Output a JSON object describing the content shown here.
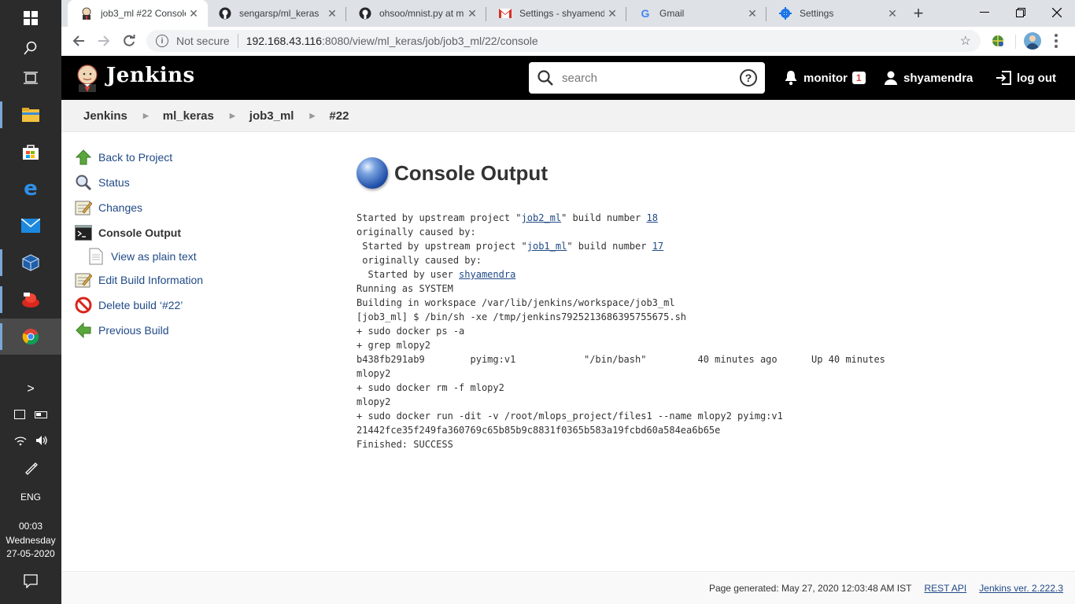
{
  "taskbar": {
    "clock_time": "00:03",
    "clock_day": "Wednesday",
    "clock_date": "27-05-2020",
    "language": "ENG",
    "chevron": ">"
  },
  "browser": {
    "tabs": [
      {
        "title": "job3_ml #22 Console",
        "icon": "jenkins-icon",
        "active": true
      },
      {
        "title": "sengarsp/ml_keras",
        "icon": "github-icon"
      },
      {
        "title": "ohsoo/mnist.py at m",
        "icon": "github-icon"
      },
      {
        "title": "Settings - shyamendr",
        "icon": "gmail-icon"
      },
      {
        "title": "Gmail",
        "icon": "google-icon"
      },
      {
        "title": "Settings",
        "icon": "gear-icon"
      }
    ],
    "new_tab": "+",
    "close": "✕",
    "not_secure": "Not secure",
    "url_host": "192.168.43.116",
    "url_path": ":8080/view/ml_keras/job/job3_ml/22/console"
  },
  "jenkins": {
    "title": "Jenkins",
    "search_placeholder": "search",
    "help": "?",
    "monitor_label": "monitor",
    "monitor_count": "1",
    "user": "shyamendra",
    "logout": "log out"
  },
  "breadcrumb": [
    "Jenkins",
    "ml_keras",
    "job3_ml",
    "#22"
  ],
  "sidepanel": {
    "back": "Back to Project",
    "status": "Status",
    "changes": "Changes",
    "console": "Console Output",
    "plain": "View as plain text",
    "edit": "Edit Build Information",
    "delete": "Delete build ‘#22’",
    "previous": "Previous Build"
  },
  "main": {
    "heading": "Console Output",
    "console": {
      "l1_pre": "Started by upstream project \"",
      "l1_link": "job2_ml",
      "l1_mid": "\" build number ",
      "l1_num": "18",
      "l2": "originally caused by:",
      "l3_pre": " Started by upstream project \"",
      "l3_link": "job1_ml",
      "l3_mid": "\" build number ",
      "l3_num": "17",
      "l4": " originally caused by:",
      "l5_pre": "  Started by user ",
      "l5_user": "shyamendra",
      "rest": "Running as SYSTEM\nBuilding in workspace /var/lib/jenkins/workspace/job3_ml\n[job3_ml] $ /bin/sh -xe /tmp/jenkins7925213686395755675.sh\n+ sudo docker ps -a\n+ grep mlopy2\nb438fb291ab9        pyimg:v1            \"/bin/bash\"         40 minutes ago      Up 40 minutes\nmlopy2\n+ sudo docker rm -f mlopy2\nmlopy2\n+ sudo docker run -dit -v /root/mlops_project/files1 --name mlopy2 pyimg:v1\n21442fce35f249fa360769c65b85b9c8831f0365b583a19fcbd60a584ea6b65e\nFinished: SUCCESS"
    }
  },
  "footer": {
    "generated": "Page generated: May 27, 2020 12:03:48 AM IST",
    "rest_api": "REST API",
    "version": "Jenkins ver. 2.222.3"
  }
}
